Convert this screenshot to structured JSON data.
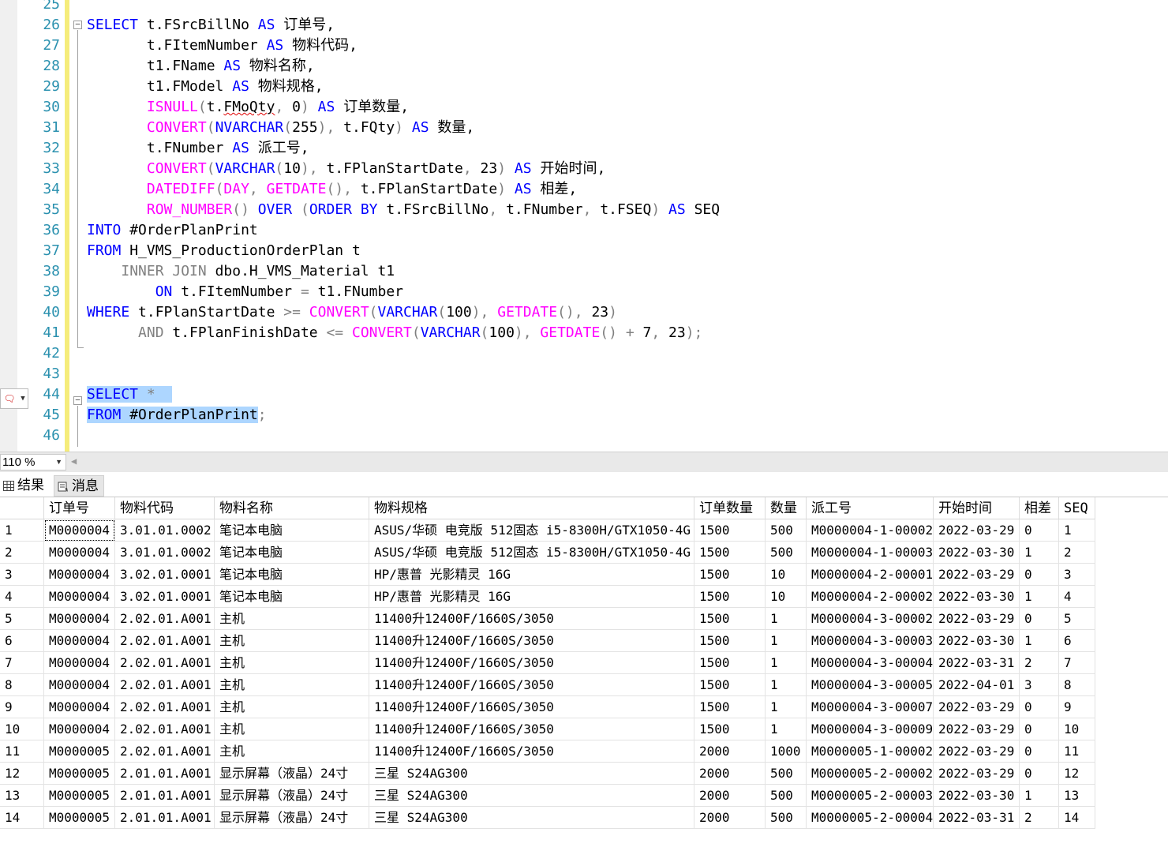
{
  "editor": {
    "line_numbers": [
      "25",
      "26",
      "27",
      "28",
      "29",
      "30",
      "31",
      "32",
      "33",
      "34",
      "35",
      "36",
      "37",
      "38",
      "39",
      "40",
      "41",
      "42",
      "43",
      "44",
      "45",
      "46"
    ],
    "lines": [
      [],
      [
        {
          "t": "SELECT",
          "c": "kw"
        },
        {
          "t": " t.FSrcBillNo "
        },
        {
          "t": "AS",
          "c": "kw"
        },
        {
          "t": " 订单号,",
          "c": ""
        }
      ],
      [
        {
          "t": "       t.FItemNumber "
        },
        {
          "t": "AS",
          "c": "kw"
        },
        {
          "t": " 物料代码,"
        }
      ],
      [
        {
          "t": "       t1.FName "
        },
        {
          "t": "AS",
          "c": "kw"
        },
        {
          "t": " 物料名称,"
        }
      ],
      [
        {
          "t": "       t1.FModel "
        },
        {
          "t": "AS",
          "c": "kw"
        },
        {
          "t": " 物料规格,"
        }
      ],
      [
        {
          "t": "       "
        },
        {
          "t": "ISNULL",
          "c": "fn"
        },
        {
          "t": "(",
          "c": "gr"
        },
        {
          "t": "t."
        },
        {
          "t": "FMoQty",
          "c": "sq"
        },
        {
          "t": ", ",
          "c": "gr"
        },
        {
          "t": "0"
        },
        {
          "t": ")",
          "c": "gr"
        },
        {
          "t": " "
        },
        {
          "t": "AS",
          "c": "kw"
        },
        {
          "t": " 订单数量,"
        }
      ],
      [
        {
          "t": "       "
        },
        {
          "t": "CONVERT",
          "c": "fn"
        },
        {
          "t": "(",
          "c": "gr"
        },
        {
          "t": "NVARCHAR",
          "c": "kw"
        },
        {
          "t": "(",
          "c": "gr"
        },
        {
          "t": "255"
        },
        {
          "t": "), ",
          "c": "gr"
        },
        {
          "t": "t.FQty"
        },
        {
          "t": ")",
          "c": "gr"
        },
        {
          "t": " "
        },
        {
          "t": "AS",
          "c": "kw"
        },
        {
          "t": " 数量,"
        }
      ],
      [
        {
          "t": "       t.FNumber "
        },
        {
          "t": "AS",
          "c": "kw"
        },
        {
          "t": " 派工号,"
        }
      ],
      [
        {
          "t": "       "
        },
        {
          "t": "CONVERT",
          "c": "fn"
        },
        {
          "t": "(",
          "c": "gr"
        },
        {
          "t": "VARCHAR",
          "c": "kw"
        },
        {
          "t": "(",
          "c": "gr"
        },
        {
          "t": "10"
        },
        {
          "t": "), ",
          "c": "gr"
        },
        {
          "t": "t.FPlanStartDate"
        },
        {
          "t": ", ",
          "c": "gr"
        },
        {
          "t": "23"
        },
        {
          "t": ")",
          "c": "gr"
        },
        {
          "t": " "
        },
        {
          "t": "AS",
          "c": "kw"
        },
        {
          "t": " 开始时间,"
        }
      ],
      [
        {
          "t": "       "
        },
        {
          "t": "DATEDIFF",
          "c": "fn"
        },
        {
          "t": "(",
          "c": "gr"
        },
        {
          "t": "DAY",
          "c": "fn"
        },
        {
          "t": ", ",
          "c": "gr"
        },
        {
          "t": "GETDATE",
          "c": "fn"
        },
        {
          "t": "(), ",
          "c": "gr"
        },
        {
          "t": "t.FPlanStartDate"
        },
        {
          "t": ")",
          "c": "gr"
        },
        {
          "t": " "
        },
        {
          "t": "AS",
          "c": "kw"
        },
        {
          "t": " 相差,"
        }
      ],
      [
        {
          "t": "       "
        },
        {
          "t": "ROW_NUMBER",
          "c": "fn"
        },
        {
          "t": "()",
          "c": "gr"
        },
        {
          "t": " "
        },
        {
          "t": "OVER",
          "c": "kw"
        },
        {
          "t": " "
        },
        {
          "t": "(",
          "c": "gr"
        },
        {
          "t": "ORDER BY",
          "c": "kw"
        },
        {
          "t": " t.FSrcBillNo"
        },
        {
          "t": ", ",
          "c": "gr"
        },
        {
          "t": "t.FNumber"
        },
        {
          "t": ", ",
          "c": "gr"
        },
        {
          "t": "t.FSEQ"
        },
        {
          "t": ")",
          "c": "gr"
        },
        {
          "t": " "
        },
        {
          "t": "AS",
          "c": "kw"
        },
        {
          "t": " SEQ"
        }
      ],
      [
        {
          "t": "INTO",
          "c": "kw"
        },
        {
          "t": " #OrderPlanPrint"
        }
      ],
      [
        {
          "t": "FROM",
          "c": "kw"
        },
        {
          "t": " H_VMS_ProductionOrderPlan t"
        }
      ],
      [
        {
          "t": "    "
        },
        {
          "t": "INNER JOIN",
          "c": "gr"
        },
        {
          "t": " dbo.H_VMS_Material t1"
        }
      ],
      [
        {
          "t": "        "
        },
        {
          "t": "ON",
          "c": "kw"
        },
        {
          "t": " t.FItemNumber "
        },
        {
          "t": "=",
          "c": "gr"
        },
        {
          "t": " t1.FNumber"
        }
      ],
      [
        {
          "t": "WHERE",
          "c": "kw"
        },
        {
          "t": " t.FPlanStartDate "
        },
        {
          "t": ">=",
          "c": "gr"
        },
        {
          "t": " "
        },
        {
          "t": "CONVERT",
          "c": "fn"
        },
        {
          "t": "(",
          "c": "gr"
        },
        {
          "t": "VARCHAR",
          "c": "kw"
        },
        {
          "t": "(",
          "c": "gr"
        },
        {
          "t": "100"
        },
        {
          "t": "), ",
          "c": "gr"
        },
        {
          "t": "GETDATE",
          "c": "fn"
        },
        {
          "t": "(), ",
          "c": "gr"
        },
        {
          "t": "23"
        },
        {
          "t": ")",
          "c": "gr"
        }
      ],
      [
        {
          "t": "      "
        },
        {
          "t": "AND",
          "c": "gr"
        },
        {
          "t": " t.FPlanFinishDate "
        },
        {
          "t": "<=",
          "c": "gr"
        },
        {
          "t": " "
        },
        {
          "t": "CONVERT",
          "c": "fn"
        },
        {
          "t": "(",
          "c": "gr"
        },
        {
          "t": "VARCHAR",
          "c": "kw"
        },
        {
          "t": "(",
          "c": "gr"
        },
        {
          "t": "100"
        },
        {
          "t": "), ",
          "c": "gr"
        },
        {
          "t": "GETDATE",
          "c": "fn"
        },
        {
          "t": "()",
          "c": "gr"
        },
        {
          "t": " "
        },
        {
          "t": "+",
          "c": "gr"
        },
        {
          "t": " 7"
        },
        {
          "t": ", ",
          "c": "gr"
        },
        {
          "t": "23"
        },
        {
          "t": ");",
          "c": "gr"
        }
      ],
      [],
      [],
      [
        {
          "t": "SELECT",
          "c": "kw sel"
        },
        {
          "t": " ",
          "c": "sel"
        },
        {
          "t": "*",
          "c": "gr sel"
        },
        {
          "t": "  ",
          "c": "sel"
        }
      ],
      [
        {
          "t": "FROM",
          "c": "kw sel"
        },
        {
          "t": " #OrderPlanPrint",
          "c": "sel"
        },
        {
          "t": ";",
          "c": "gr"
        }
      ],
      []
    ]
  },
  "zoom": {
    "value": "110 %"
  },
  "tabs": {
    "results": "结果",
    "messages": "消息"
  },
  "grid": {
    "columns": [
      "订单号",
      "物料代码",
      "物料名称",
      "物料规格",
      "订单数量",
      "数量",
      "派工号",
      "开始时间",
      "相差",
      "SEQ"
    ],
    "rows": [
      [
        "1",
        "M0000004",
        "3.01.01.0002",
        "笔记本电脑",
        "ASUS/华硕 电竞版 512固态 i5-8300H/GTX1050-4G",
        "1500",
        "500",
        "M0000004-1-00002",
        "2022-03-29",
        "0",
        "1"
      ],
      [
        "2",
        "M0000004",
        "3.01.01.0002",
        "笔记本电脑",
        "ASUS/华硕 电竞版 512固态 i5-8300H/GTX1050-4G",
        "1500",
        "500",
        "M0000004-1-00003",
        "2022-03-30",
        "1",
        "2"
      ],
      [
        "3",
        "M0000004",
        "3.02.01.0001",
        "笔记本电脑",
        "HP/惠普 光影精灵 16G",
        "1500",
        "10",
        "M0000004-2-00001",
        "2022-03-29",
        "0",
        "3"
      ],
      [
        "4",
        "M0000004",
        "3.02.01.0001",
        "笔记本电脑",
        "HP/惠普 光影精灵 16G",
        "1500",
        "10",
        "M0000004-2-00002",
        "2022-03-30",
        "1",
        "4"
      ],
      [
        "5",
        "M0000004",
        "2.02.01.A001",
        "主机",
        "11400升12400F/1660S/3050",
        "1500",
        "1",
        "M0000004-3-00002",
        "2022-03-29",
        "0",
        "5"
      ],
      [
        "6",
        "M0000004",
        "2.02.01.A001",
        "主机",
        "11400升12400F/1660S/3050",
        "1500",
        "1",
        "M0000004-3-00003",
        "2022-03-30",
        "1",
        "6"
      ],
      [
        "7",
        "M0000004",
        "2.02.01.A001",
        "主机",
        "11400升12400F/1660S/3050",
        "1500",
        "1",
        "M0000004-3-00004",
        "2022-03-31",
        "2",
        "7"
      ],
      [
        "8",
        "M0000004",
        "2.02.01.A001",
        "主机",
        "11400升12400F/1660S/3050",
        "1500",
        "1",
        "M0000004-3-00005",
        "2022-04-01",
        "3",
        "8"
      ],
      [
        "9",
        "M0000004",
        "2.02.01.A001",
        "主机",
        "11400升12400F/1660S/3050",
        "1500",
        "1",
        "M0000004-3-00007",
        "2022-03-29",
        "0",
        "9"
      ],
      [
        "10",
        "M0000004",
        "2.02.01.A001",
        "主机",
        "11400升12400F/1660S/3050",
        "1500",
        "1",
        "M0000004-3-00009",
        "2022-03-29",
        "0",
        "10"
      ],
      [
        "11",
        "M0000005",
        "2.02.01.A001",
        "主机",
        "11400升12400F/1660S/3050",
        "2000",
        "1000",
        "M0000005-1-00002",
        "2022-03-29",
        "0",
        "11"
      ],
      [
        "12",
        "M0000005",
        "2.01.01.A001",
        "显示屏幕（液晶）24寸",
        "三星 S24AG300",
        "2000",
        "500",
        "M0000005-2-00002",
        "2022-03-29",
        "0",
        "12"
      ],
      [
        "13",
        "M0000005",
        "2.01.01.A001",
        "显示屏幕（液晶）24寸",
        "三星 S24AG300",
        "2000",
        "500",
        "M0000005-2-00003",
        "2022-03-30",
        "1",
        "13"
      ],
      [
        "14",
        "M0000005",
        "2.01.01.A001",
        "显示屏幕（液晶）24寸",
        "三星 S24AG300",
        "2000",
        "500",
        "M0000005-2-00004",
        "2022-03-31",
        "2",
        "14"
      ]
    ]
  }
}
